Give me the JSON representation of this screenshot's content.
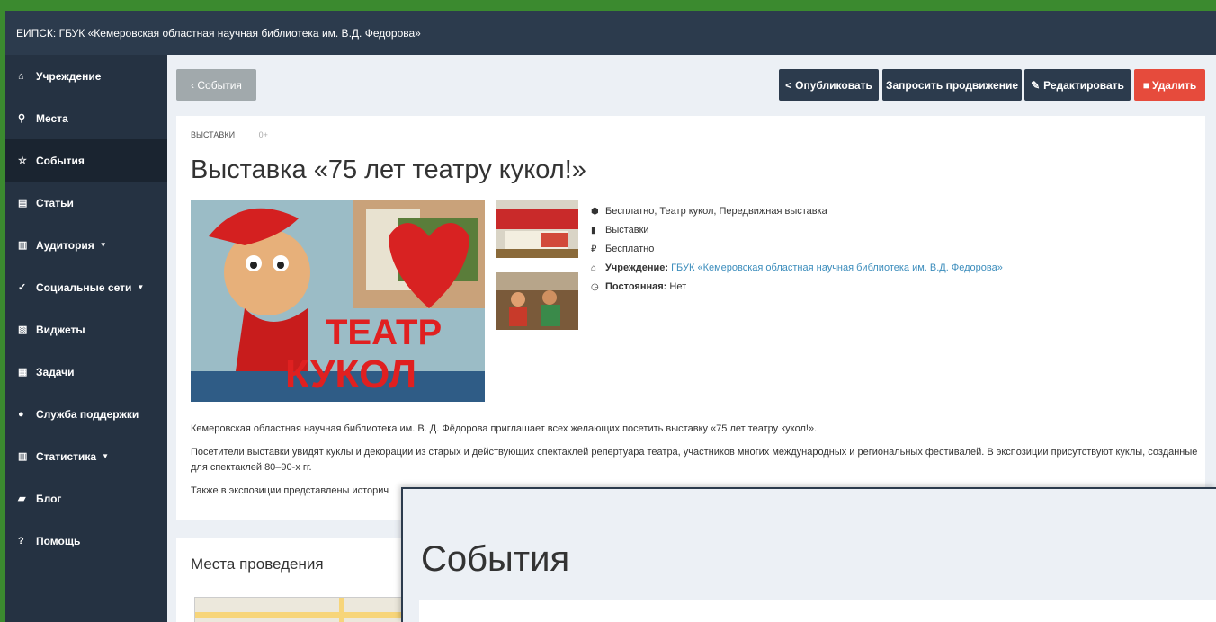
{
  "topbar": {
    "title": "ЕИПСК: ГБУК «Кемеровская областная научная библиотека им. В.Д. Федорова»"
  },
  "sidebar": {
    "items": [
      {
        "label": "Учреждение",
        "icon": "home-icon",
        "glyph": "⌂",
        "caret": ""
      },
      {
        "label": "Места",
        "icon": "map-marker-icon",
        "glyph": "⚲",
        "caret": ""
      },
      {
        "label": "События",
        "icon": "star-icon",
        "glyph": "☆",
        "caret": ""
      },
      {
        "label": "Статьи",
        "icon": "newspaper-icon",
        "glyph": "▤",
        "caret": ""
      },
      {
        "label": "Аудитория",
        "icon": "bar-chart-icon",
        "glyph": "▥",
        "caret": "▼"
      },
      {
        "label": "Социальные сети",
        "icon": "vk-icon",
        "glyph": "✓",
        "caret": "▼"
      },
      {
        "label": "Виджеты",
        "icon": "image-icon",
        "glyph": "▧",
        "caret": ""
      },
      {
        "label": "Задачи",
        "icon": "tasks-icon",
        "glyph": "▦",
        "caret": ""
      },
      {
        "label": "Служба поддержки",
        "icon": "comments-icon",
        "glyph": "●",
        "caret": ""
      },
      {
        "label": "Статистика",
        "icon": "bar-chart-icon",
        "glyph": "▥",
        "caret": "▼"
      },
      {
        "label": "Блог",
        "icon": "book-icon",
        "glyph": "▰",
        "caret": ""
      },
      {
        "label": "Помощь",
        "icon": "question-circle-icon",
        "glyph": "?",
        "caret": ""
      }
    ]
  },
  "toolbar": {
    "back_label": "‹ События",
    "publish_label": "Опубликовать",
    "promote_label": "Запросить продвижение",
    "edit_label": "Редактировать",
    "delete_label": "Удалить",
    "delete_color": "#e64b3c",
    "dark_color": "#2c3b4d"
  },
  "event": {
    "category": "ВЫСТАВКИ",
    "age": "0+",
    "title": "Выставка «75 лет театру кукол!»",
    "tags": "Бесплатно, Театр кукол, Передвижная выставка",
    "type": "Выставки",
    "price": "Бесплатно",
    "org_label": "Учреждение:",
    "org_value": "ГБУК «Кемеровская областная научная библиотека им. В.Д. Федорова»",
    "permanent_label": "Постоянная:",
    "permanent_value": "Нет",
    "photo_text_top": "ТЕАТР",
    "photo_text_bottom": "КУКОЛ",
    "desc1": "Кемеровская областная научная библиотека им. В. Д. Фёдорова приглашает всех желающих посетить выставку «75 лет театру кукол!».",
    "desc2": "Посетители выставки увидят куклы и декорации из старых и действующих спектаклей репертуара театра, участников многих международных и региональных фестивалей. В экспозиции присутствуют куклы, созданные для спектаклей 80–90-х гг.",
    "desc3": "Также в экспозиции представлены историч"
  },
  "places": {
    "title": "Места проведения"
  },
  "overlay": {
    "title": "События"
  }
}
